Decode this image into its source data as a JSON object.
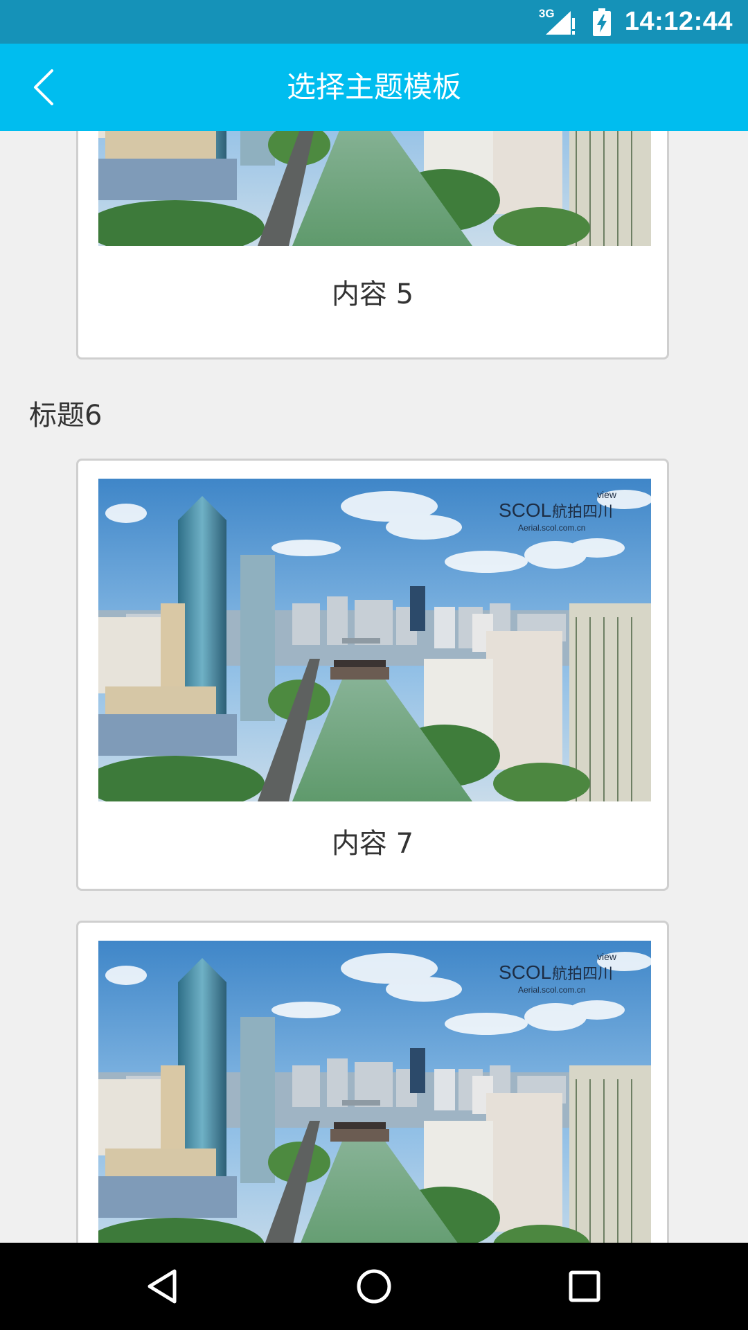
{
  "status_bar": {
    "network": "3G",
    "time": "14:12:44",
    "icons": [
      "signal-icon",
      "battery-charging-icon"
    ]
  },
  "header": {
    "back_icon": "chevron-left-icon",
    "title": "选择主题模板"
  },
  "colors": {
    "status_bar": "#1592b8",
    "app_bar": "#00bdef",
    "background": "#f0f0f0",
    "card_border": "#cfcfcf"
  },
  "watermark": {
    "brand": "SCOL",
    "chinese": "航拍四川",
    "tag": "view",
    "url": "Aerial.scol.com.cn"
  },
  "cards": [
    {
      "label": "内容 5"
    },
    {
      "label": "内容 7"
    },
    {
      "label": ""
    }
  ],
  "sections": [
    {
      "title": "标题6"
    }
  ],
  "nav": {
    "back_icon": "nav-back-icon",
    "home_icon": "nav-home-icon",
    "recents_icon": "nav-recents-icon"
  }
}
